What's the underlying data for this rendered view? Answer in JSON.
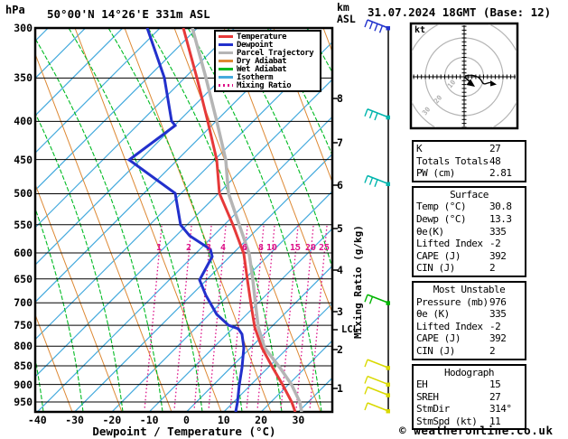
{
  "header": {
    "pressure_unit": "hPa",
    "title": "50°00'N 14°26'E 331m ASL",
    "date": "31.07.2024 18GMT (Base: 12)",
    "km_label": "km",
    "asl_label": "ASL"
  },
  "axes": {
    "pressure_ticks": [
      300,
      350,
      400,
      450,
      500,
      550,
      600,
      650,
      700,
      750,
      800,
      850,
      900,
      950
    ],
    "temp_ticks": [
      -40,
      -30,
      -20,
      -10,
      0,
      10,
      20,
      30
    ],
    "x_title": "Dewpoint / Temperature (°C)",
    "km_ticks": [
      8,
      7,
      6,
      5,
      4,
      3,
      2,
      1
    ],
    "lcl_label": "LCL",
    "mixing_axis_label": "Mixing Ratio (g/kg)",
    "mixing_ratio_labels": [
      "1",
      "2",
      "3",
      "4",
      "6",
      "8",
      "10",
      "15",
      "20",
      "25"
    ]
  },
  "legend": {
    "items": [
      {
        "label": "Temperature",
        "color": "#e63939",
        "style": "solid"
      },
      {
        "label": "Dewpoint",
        "color": "#2230cc",
        "style": "solid"
      },
      {
        "label": "Parcel Trajectory",
        "color": "#b5b5b5",
        "style": "solid"
      },
      {
        "label": "Dry Adiabat",
        "color": "#dd8833",
        "style": "solid"
      },
      {
        "label": "Wet Adiabat",
        "color": "#00bb22",
        "style": "solid"
      },
      {
        "label": "Isotherm",
        "color": "#44aadd",
        "style": "solid"
      },
      {
        "label": "Mixing Ratio",
        "color": "#dd1188",
        "style": "dotted"
      }
    ]
  },
  "hodograph": {
    "unit": "kt",
    "rings": [
      "10",
      "20",
      "30"
    ]
  },
  "tables": [
    {
      "title": "",
      "rows": [
        [
          "K",
          "27"
        ],
        [
          "Totals Totals",
          "48"
        ],
        [
          "PW (cm)",
          "2.81"
        ]
      ]
    },
    {
      "title": "Surface",
      "rows": [
        [
          "Temp (°C)",
          "30.8"
        ],
        [
          "Dewp (°C)",
          "13.3"
        ],
        [
          "θe(K)",
          "335"
        ],
        [
          "Lifted Index",
          "-2"
        ],
        [
          "CAPE (J)",
          "392"
        ],
        [
          "CIN (J)",
          "2"
        ]
      ]
    },
    {
      "title": "Most Unstable",
      "rows": [
        [
          "Pressure (mb)",
          "976"
        ],
        [
          "θe (K)",
          "335"
        ],
        [
          "Lifted Index",
          "-2"
        ],
        [
          "CAPE (J)",
          "392"
        ],
        [
          "CIN (J)",
          "2"
        ]
      ]
    },
    {
      "title": "Hodograph",
      "rows": [
        [
          "EH",
          "15"
        ],
        [
          "SREH",
          "27"
        ],
        [
          "StmDir",
          "314°"
        ],
        [
          "StmSpd (kt)",
          "11"
        ]
      ]
    }
  ],
  "footer": {
    "copyright": "© weatheronline.co.uk"
  },
  "chart_data": {
    "type": "line",
    "title": "Skew-T log-P sounding",
    "location": "50°00'N 14°26'E 331m ASL",
    "datetime": "31.07.2024 18GMT (Base: 12)",
    "xlabel": "Dewpoint / Temperature (°C)",
    "ylabel": "Pressure (hPa)",
    "xlim": [
      -45,
      40
    ],
    "pressure_range_hPa": [
      300,
      980
    ],
    "secondary_axis_km_ASL": [
      1,
      2,
      3,
      4,
      5,
      6,
      7,
      8
    ],
    "lcl_km_approx": 2.4,
    "mixing_ratio_lines_g_kg": [
      1,
      2,
      3,
      4,
      6,
      8,
      10,
      15,
      20,
      25
    ],
    "series": [
      {
        "name": "Temperature",
        "color": "#e63939",
        "units": "°C",
        "points": [
          [
            300,
            -41
          ],
          [
            350,
            -32
          ],
          [
            400,
            -23.5
          ],
          [
            450,
            -16
          ],
          [
            500,
            -10
          ],
          [
            550,
            -5
          ],
          [
            600,
            -0.5
          ],
          [
            650,
            3.5
          ],
          [
            700,
            7.5
          ],
          [
            750,
            11
          ],
          [
            800,
            15
          ],
          [
            850,
            19.5
          ],
          [
            900,
            23.5
          ],
          [
            950,
            27.5
          ],
          [
            976,
            30.8
          ]
        ]
      },
      {
        "name": "Dewpoint",
        "color": "#2230cc",
        "units": "°C",
        "points": [
          [
            300,
            -44
          ],
          [
            350,
            -35
          ],
          [
            400,
            -28
          ],
          [
            450,
            -38
          ],
          [
            500,
            -20
          ],
          [
            550,
            -14
          ],
          [
            600,
            -4
          ],
          [
            650,
            -13
          ],
          [
            700,
            -1
          ],
          [
            750,
            8
          ],
          [
            800,
            11
          ],
          [
            850,
            11.5
          ],
          [
            900,
            12
          ],
          [
            950,
            13
          ],
          [
            976,
            13.3
          ]
        ]
      },
      {
        "name": "Parcel Trajectory",
        "color": "#b5b5b5",
        "units": "°C",
        "points": [
          [
            300,
            -40
          ],
          [
            350,
            -31
          ],
          [
            400,
            -22.5
          ],
          [
            450,
            -15
          ],
          [
            500,
            -9.5
          ],
          [
            550,
            -4.5
          ],
          [
            600,
            0
          ],
          [
            650,
            4
          ],
          [
            700,
            8
          ],
          [
            750,
            11.5
          ],
          [
            800,
            16
          ],
          [
            850,
            20.5
          ],
          [
            900,
            24.5
          ],
          [
            950,
            28.5
          ],
          [
            976,
            30.8
          ]
        ]
      }
    ],
    "wind_barbs": [
      {
        "pressure": 300,
        "color": "#2233cc",
        "feathers": 4
      },
      {
        "pressure": 395,
        "color": "#00b5ad",
        "feathers": 3
      },
      {
        "pressure": 485,
        "color": "#00b5ad",
        "feathers": 3
      },
      {
        "pressure": 700,
        "color": "#00b400",
        "feathers": 2
      },
      {
        "pressure": 855,
        "color": "#d9d900",
        "feathers": 1
      },
      {
        "pressure": 900,
        "color": "#d9d900",
        "feathers": 1
      },
      {
        "pressure": 930,
        "color": "#d9d900",
        "feathers": 1
      },
      {
        "pressure": 978,
        "color": "#d9d900",
        "feathers": 1
      }
    ],
    "indices": {
      "K": 27,
      "Totals_Totals": 48,
      "PW_cm": 2.81,
      "surface": {
        "Temp_C": 30.8,
        "Dewp_C": 13.3,
        "ThetaE_K": 335,
        "Lifted_Index": -2,
        "CAPE_J": 392,
        "CIN_J": 2
      },
      "most_unstable": {
        "Pressure_mb": 976,
        "ThetaE_K": 335,
        "Lifted_Index": -2,
        "CAPE_J": 392,
        "CIN_J": 2
      },
      "hodograph": {
        "EH": 15,
        "SREH": 27,
        "StmDir_deg": 314,
        "StmSpd_kt": 11
      }
    },
    "legend_position": "top-right-inside",
    "grid": true
  }
}
